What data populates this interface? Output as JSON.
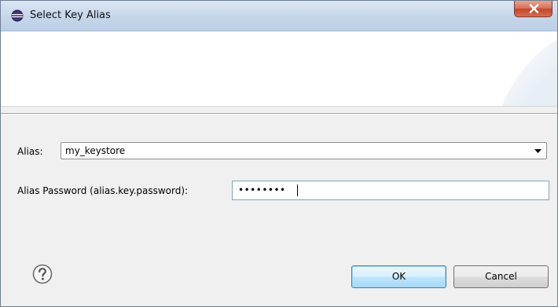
{
  "window": {
    "title": "Select Key Alias",
    "title_icon": "eclipse-icon",
    "close_icon": "close-icon"
  },
  "form": {
    "alias_label": "Alias:",
    "alias_value": "my_keystore",
    "password_label": "Alias Password (alias.key.password):",
    "password_masked": "••••••••"
  },
  "footer": {
    "help_icon": "help-icon",
    "ok_label": "OK",
    "cancel_label": "Cancel"
  },
  "colors": {
    "title_bar": "#c6d6ea",
    "close_button": "#c2452c",
    "default_button": "#bee6fd",
    "dialog_background": "#f0f0f0"
  }
}
